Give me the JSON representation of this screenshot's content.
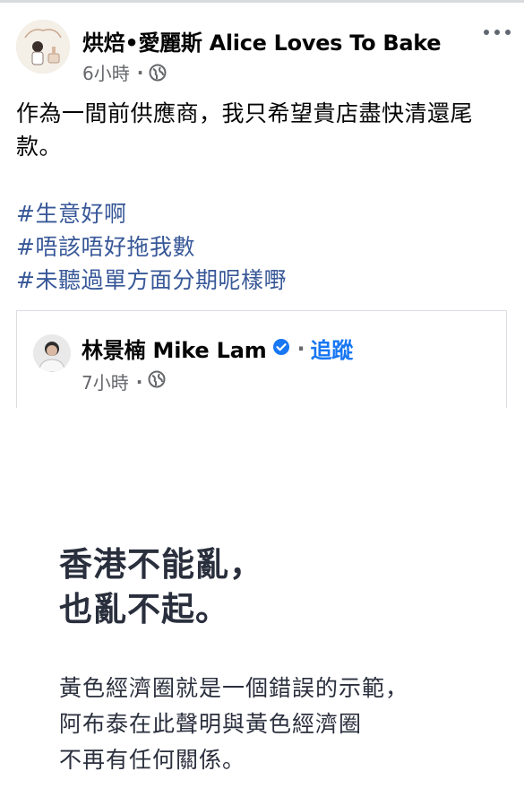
{
  "post": {
    "page_name": "烘焙•愛麗斯 Alice Loves To Bake",
    "time": "6小時",
    "text": "作為一間前供應商，我只希望貴店盡快清還尾款。",
    "hashtags": [
      "#生意好啊",
      "#唔該唔好拖我數",
      "#未聽過單方面分期呢樣嘢"
    ]
  },
  "shared": {
    "name": "林景楠 Mike Lam",
    "follow_label": "追蹤",
    "time": "7小時",
    "image_text": {
      "heading": [
        "香港不能亂，",
        "也亂不起。"
      ],
      "body": [
        "黃色經濟圈就是一個錯誤的示範，",
        "阿布泰在此聲明與黃色經濟圈",
        "不再有任何關係。"
      ]
    }
  },
  "icons": {
    "privacy": "globe-icon",
    "more": "more-options-icon",
    "verified": "verified-badge-icon"
  },
  "colors": {
    "link": "#385898",
    "follow": "#1877f2",
    "meta": "#65676b"
  }
}
